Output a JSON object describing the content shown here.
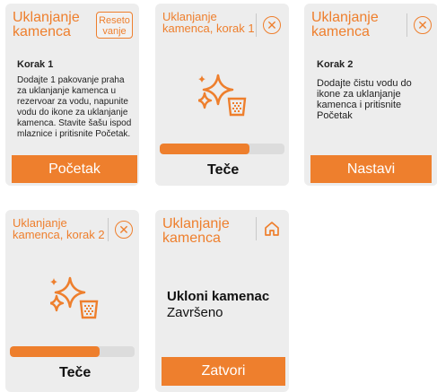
{
  "colors": {
    "accent": "#ee7f2d",
    "card_bg": "#ededed",
    "track": "#dcdcdc"
  },
  "card1": {
    "title": "Uklanjanje\nkamenca",
    "reset_label": "Reseto\nvanje",
    "step_title": "Korak 1",
    "step_text": "Dodajte 1 pakovanje praha\nza uklanjanje kamenca u\nrezervoar za vodu, napunite\nvodu do ikone za uklanjanje\nkamenca. Stavite šašu ispod\nmlaznice i pritisnite Početak.",
    "button": "Početak"
  },
  "card2": {
    "title": "Uklanjanje\nkamenca, korak 1",
    "icon": "descale-sparkle-icon",
    "progress": 0.72,
    "status": "Teče"
  },
  "card3": {
    "title": "Uklanjanje\nkamenca",
    "step_title": "Korak 2",
    "step_text": "Dodajte čistu vodu do\nikone za uklanjanje\nkamenca i pritisnite\nPočetak",
    "button": "Nastavi"
  },
  "card4": {
    "title": "Uklanjanje\nkamenca, korak 2",
    "icon": "descale-sparkle-icon",
    "progress": 0.72,
    "status": "Teče"
  },
  "card5": {
    "title": "Uklanjanje\nkamenca",
    "icon": "home-icon",
    "heading": "Ukloni kamenac",
    "subheading": "Završeno",
    "button": "Zatvori"
  }
}
